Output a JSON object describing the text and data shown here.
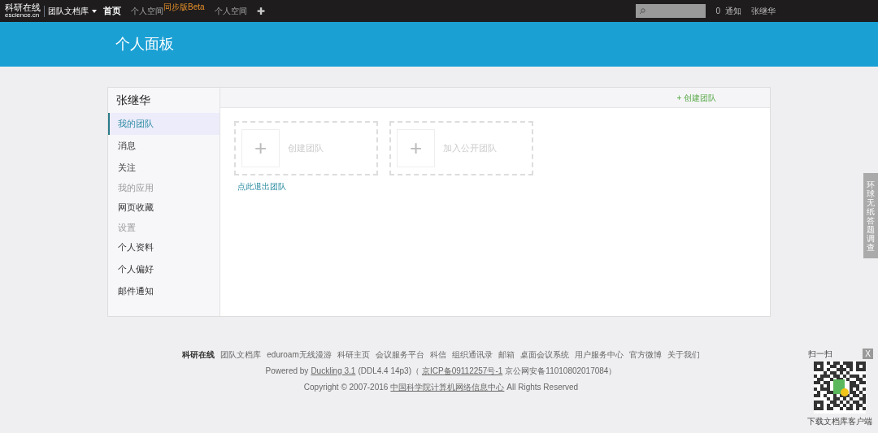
{
  "topbar": {
    "logo_cn": "科研在线",
    "logo_en": "escience.cn",
    "product": "团队文档库",
    "nav": [
      {
        "label": "首页",
        "selected": true
      },
      {
        "label": "个人空间",
        "selected": false,
        "badge": "同步版Beta"
      },
      {
        "label": "个人空间",
        "selected": false
      }
    ],
    "plus": "✚",
    "notify_count": "0",
    "notify_label": "通知",
    "user": "张继华"
  },
  "banner": {
    "title": "个人面板"
  },
  "sidebar": {
    "user": "张继华",
    "items": [
      {
        "label": "我的团队",
        "kind": "item",
        "selected": true
      },
      {
        "label": "消息",
        "kind": "item",
        "selected": false
      },
      {
        "label": "关注",
        "kind": "item",
        "selected": false
      },
      {
        "label": "我的应用",
        "kind": "header"
      },
      {
        "label": "网页收藏",
        "kind": "item",
        "selected": false
      },
      {
        "label": "设置",
        "kind": "header"
      },
      {
        "label": "个人资料",
        "kind": "item",
        "selected": false
      },
      {
        "label": "个人偏好",
        "kind": "item",
        "selected": false
      },
      {
        "label": "邮件通知",
        "kind": "item",
        "selected": false
      }
    ]
  },
  "content": {
    "create_link": "+ 创建团队",
    "tiles": [
      {
        "plus": "+",
        "label": "创建团队"
      },
      {
        "plus": "+",
        "label": "加入公开团队"
      }
    ],
    "exit_link": "点此退出团队"
  },
  "footer": {
    "brand": "科研在线",
    "links": [
      "团队文档库",
      "eduroam无线漫游",
      "科研主页",
      "会议服务平台",
      "科信",
      "组织通讯录",
      "邮箱",
      "桌面会议系统",
      "用户服务中心",
      "官方微博",
      "关于我们"
    ],
    "powered_prefix": "Powered by",
    "powered_link": "Duckling 3.1",
    "powered_version": "(DDL4.4 14p3)（",
    "icp": "京ICP备09112257号-1",
    "police": "京公网安备11010802017084）",
    "copyright_prefix": "Copyright © 2007-2016",
    "copyright_link": "中国科学院计算机网络信息中心",
    "copyright_suffix": "All Rights Reserved"
  },
  "side_tab": "环球无纸答题调查",
  "qr": {
    "title": "扫一扫",
    "close": "X",
    "caption": "下载文档库客户端"
  }
}
